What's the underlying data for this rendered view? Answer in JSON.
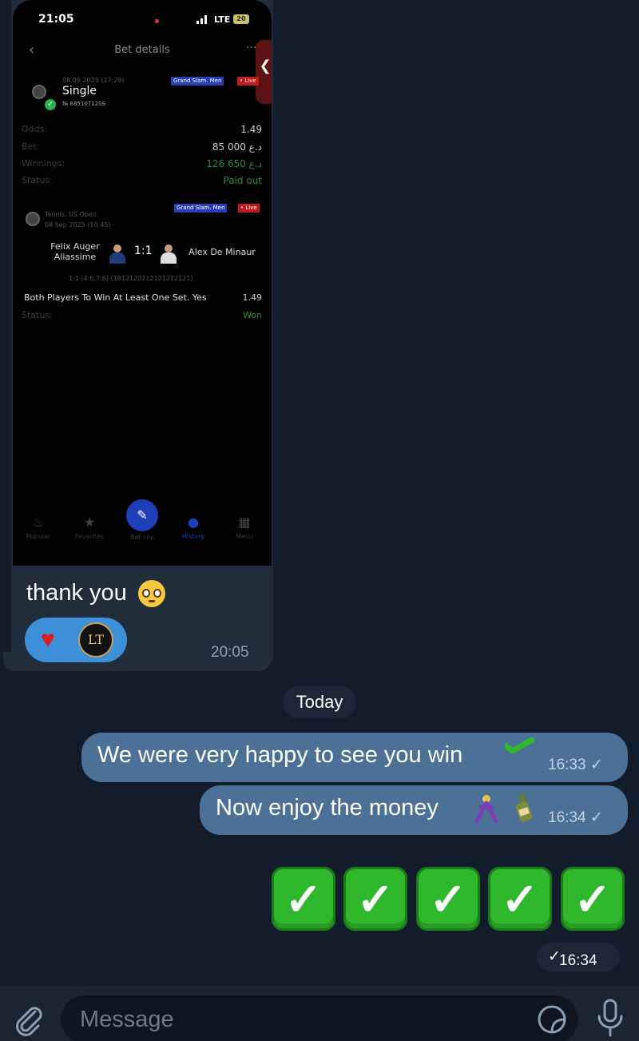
{
  "screenshot": {
    "status_time": "21:05",
    "network": "LTE",
    "battery": "20",
    "nav_title": "Bet details",
    "bet_date": "08.09.2025 (17:29)",
    "bet_type": "Single",
    "coupon": "№ 68510712SS",
    "badges": {
      "top_blue": "Grand Slam. Men",
      "top_red": "• Live",
      "mid_blue": "Grand Slam. Men",
      "mid_red": "• Live"
    },
    "rows": [
      {
        "label": "Odds:",
        "value": "1.49",
        "color": "#cfcfcf"
      },
      {
        "label": "Bet:",
        "value": "85 000 د.ع",
        "color": "#cfcfcf"
      },
      {
        "label": "Winnings:",
        "value": "126 650 د.ع",
        "color": "#2e8b3e"
      },
      {
        "label": "Status:",
        "value": "Paid out",
        "color": "#2e8b3e"
      }
    ],
    "match_sport": "Tennis. US Open",
    "match_date": "08 Sep 2025 (10:45)",
    "player1": "Felix Auger Aliassime",
    "player2": "Alex De Minaur",
    "score": "1:1",
    "score_detail": "1:1 (4:6,7:6) (1812120212121212121)",
    "market": "Both Players To Win At Least One Set. Yes",
    "market_odds": "1.49",
    "status_label": "Status:",
    "status_value": "Won",
    "tabbar": [
      "Popular",
      "Favorites",
      "Bet slip",
      "History",
      "Menu"
    ]
  },
  "incoming": {
    "text": "thank you",
    "emoji": "pleading-face",
    "reaction": "heart",
    "reactor_initials": "LT",
    "time": "20:05"
  },
  "date_separator": "Today",
  "outgoing": [
    {
      "text": "We were very happy to see you win",
      "emoji": "check-mark",
      "time": "16:33"
    },
    {
      "text": "Now enjoy the money",
      "emoji": "dancer-bottle",
      "time": "16:34"
    }
  ],
  "checks_message": {
    "count": 5,
    "glyph": "✓",
    "time": "16:34"
  },
  "input": {
    "placeholder": "Message"
  },
  "colors": {
    "background": "#131c2b",
    "incoming": "#212d3b",
    "outgoing": "#4d7196",
    "reaction": "#3c8fd8",
    "check_green": "#2fb82c"
  }
}
